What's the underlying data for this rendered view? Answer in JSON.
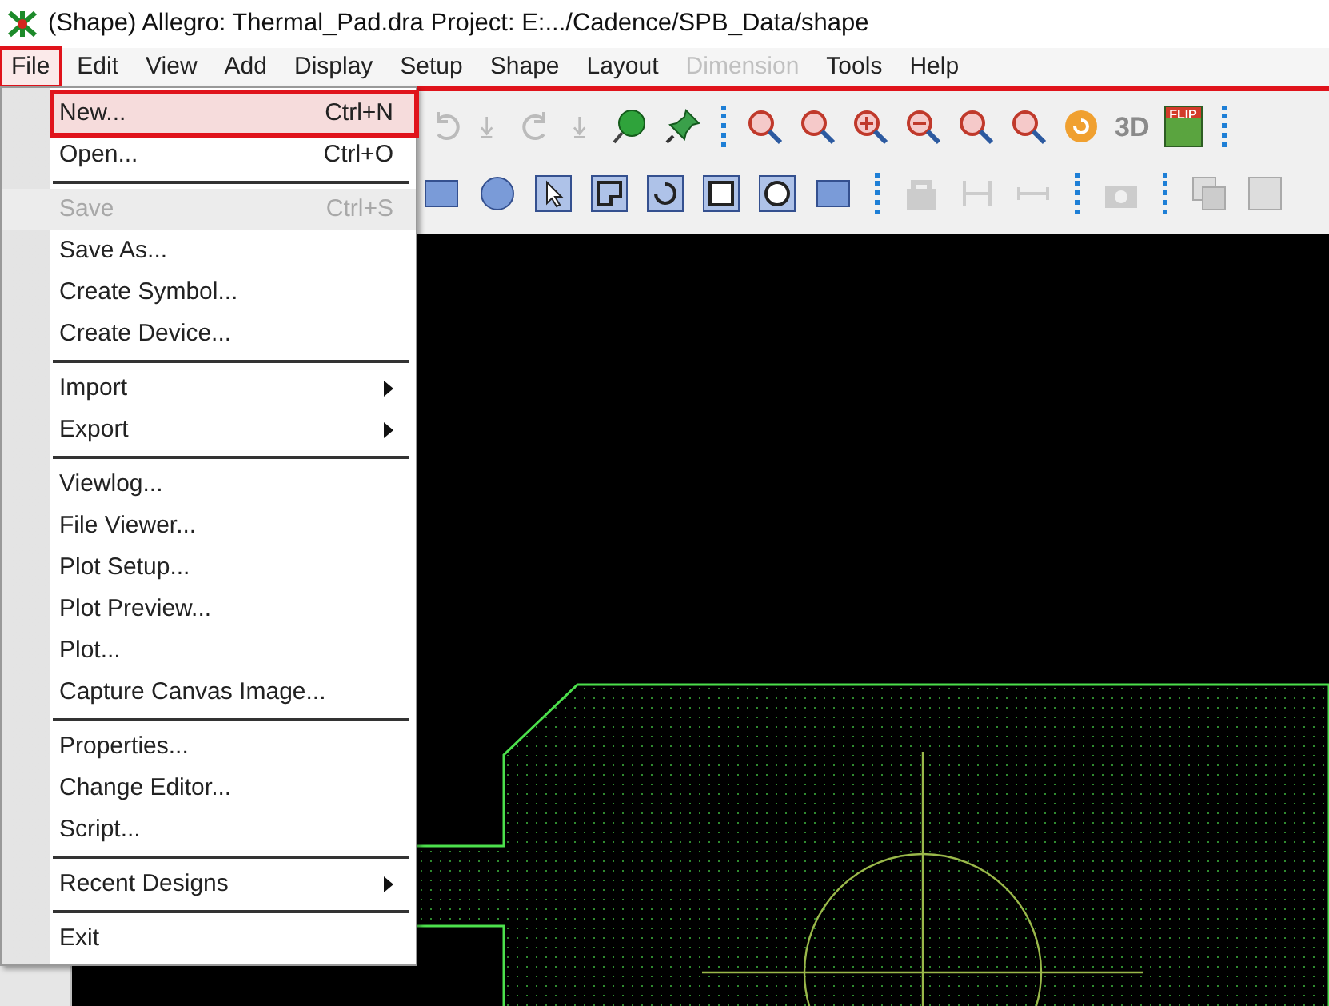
{
  "window": {
    "title": "(Shape) Allegro: Thermal_Pad.dra  Project: E:.../Cadence/SPB_Data/shape"
  },
  "menu_bar": [
    {
      "label": "File",
      "selected": true,
      "disabled": false
    },
    {
      "label": "Edit",
      "selected": false,
      "disabled": false
    },
    {
      "label": "View",
      "selected": false,
      "disabled": false
    },
    {
      "label": "Add",
      "selected": false,
      "disabled": false
    },
    {
      "label": "Display",
      "selected": false,
      "disabled": false
    },
    {
      "label": "Setup",
      "selected": false,
      "disabled": false
    },
    {
      "label": "Shape",
      "selected": false,
      "disabled": false
    },
    {
      "label": "Layout",
      "selected": false,
      "disabled": false
    },
    {
      "label": "Dimension",
      "selected": false,
      "disabled": true
    },
    {
      "label": "Tools",
      "selected": false,
      "disabled": false
    },
    {
      "label": "Help",
      "selected": false,
      "disabled": false
    }
  ],
  "file_menu": [
    {
      "kind": "item",
      "label": "New...",
      "shortcut": "Ctrl+N",
      "selected": true,
      "disabled": false
    },
    {
      "kind": "item",
      "label": "Open...",
      "shortcut": "Ctrl+O",
      "selected": false,
      "disabled": false
    },
    {
      "kind": "separator"
    },
    {
      "kind": "item",
      "label": "Save",
      "shortcut": "Ctrl+S",
      "selected": false,
      "disabled": true
    },
    {
      "kind": "item",
      "label": "Save As...",
      "selected": false,
      "disabled": false
    },
    {
      "kind": "item",
      "label": "Create Symbol...",
      "selected": false,
      "disabled": false
    },
    {
      "kind": "item",
      "label": "Create Device...",
      "selected": false,
      "disabled": false
    },
    {
      "kind": "separator"
    },
    {
      "kind": "submenu",
      "label": "Import",
      "selected": false,
      "disabled": false
    },
    {
      "kind": "submenu",
      "label": "Export",
      "selected": false,
      "disabled": false
    },
    {
      "kind": "separator"
    },
    {
      "kind": "item",
      "label": "Viewlog...",
      "selected": false,
      "disabled": false
    },
    {
      "kind": "item",
      "label": "File Viewer...",
      "selected": false,
      "disabled": false
    },
    {
      "kind": "item",
      "label": "Plot Setup...",
      "selected": false,
      "disabled": false
    },
    {
      "kind": "item",
      "label": "Plot Preview...",
      "selected": false,
      "disabled": false
    },
    {
      "kind": "item",
      "label": "Plot...",
      "selected": false,
      "disabled": false
    },
    {
      "kind": "item",
      "label": "Capture Canvas Image...",
      "selected": false,
      "disabled": false
    },
    {
      "kind": "separator"
    },
    {
      "kind": "item",
      "label": "Properties...",
      "selected": false,
      "disabled": false
    },
    {
      "kind": "item",
      "label": "Change Editor...",
      "selected": false,
      "disabled": false
    },
    {
      "kind": "item",
      "label": "Script...",
      "selected": false,
      "disabled": false
    },
    {
      "kind": "separator"
    },
    {
      "kind": "submenu",
      "label": "Recent Designs",
      "selected": false,
      "disabled": false
    },
    {
      "kind": "separator"
    },
    {
      "kind": "item",
      "label": "Exit",
      "selected": false,
      "disabled": false
    }
  ],
  "toolbar": {
    "highlighted": true
  },
  "canvas_toolbar_badges": [
    "3D",
    "FLIP"
  ]
}
